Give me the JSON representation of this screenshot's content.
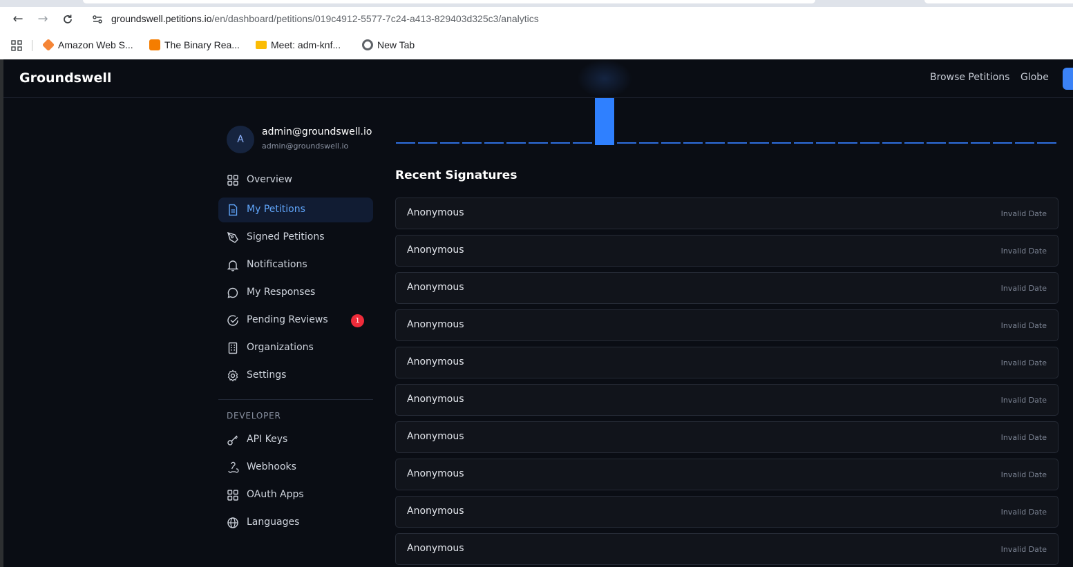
{
  "browser": {
    "url_host": "groundswell.petitions.io",
    "url_path": "/en/dashboard/petitions/019c4912-5577-7c24-a413-829403d325c3/analytics",
    "bookmarks": [
      {
        "label": "Amazon Web S...",
        "icon": "aws-icon",
        "color": "#f58536"
      },
      {
        "label": "The Binary Rea...",
        "icon": "blogger-icon",
        "color": "#f57d00"
      },
      {
        "label": "Meet: adm-knf...",
        "icon": "meet-icon",
        "color": "#fbbc04"
      },
      {
        "label": "New Tab",
        "icon": "chrome-icon",
        "color": "#5f6368"
      }
    ]
  },
  "header": {
    "brand": "Groundswell",
    "links": [
      "Browse Petitions",
      "Globe"
    ]
  },
  "user": {
    "initial": "A",
    "name": "admin@groundswell.io",
    "email": "admin@groundswell.io"
  },
  "sidebar": {
    "items": [
      {
        "label": "Overview",
        "icon": "grid-icon"
      },
      {
        "label": "My Petitions",
        "icon": "document-icon",
        "active": true
      },
      {
        "label": "Signed Petitions",
        "icon": "pen-icon"
      },
      {
        "label": "Notifications",
        "icon": "bell-icon"
      },
      {
        "label": "My Responses",
        "icon": "chat-icon"
      },
      {
        "label": "Pending Reviews",
        "icon": "check-circle-icon",
        "badge": "1"
      },
      {
        "label": "Organizations",
        "icon": "building-icon"
      },
      {
        "label": "Settings",
        "icon": "gear-icon"
      }
    ],
    "developer_label": "DEVELOPER",
    "developer_items": [
      {
        "label": "API Keys",
        "icon": "key-icon"
      },
      {
        "label": "Webhooks",
        "icon": "webhook-icon"
      },
      {
        "label": "OAuth Apps",
        "icon": "grid-icon"
      },
      {
        "label": "Languages",
        "icon": "globe-icon"
      }
    ]
  },
  "chart_data": {
    "type": "bar",
    "bar_count": 30,
    "values": [
      0,
      0,
      0,
      0,
      0,
      0,
      0,
      0,
      0,
      1,
      0,
      0,
      0,
      0,
      0,
      0,
      0,
      0,
      0,
      0,
      0,
      0,
      0,
      0,
      0,
      0,
      0,
      0,
      0,
      0
    ],
    "colors": {
      "bar": "#2f80ff",
      "baseline": "#2f6fe0"
    }
  },
  "signatures": {
    "title": "Recent Signatures",
    "rows": [
      {
        "name": "Anonymous",
        "date": "Invalid Date"
      },
      {
        "name": "Anonymous",
        "date": "Invalid Date"
      },
      {
        "name": "Anonymous",
        "date": "Invalid Date"
      },
      {
        "name": "Anonymous",
        "date": "Invalid Date"
      },
      {
        "name": "Anonymous",
        "date": "Invalid Date"
      },
      {
        "name": "Anonymous",
        "date": "Invalid Date"
      },
      {
        "name": "Anonymous",
        "date": "Invalid Date"
      },
      {
        "name": "Anonymous",
        "date": "Invalid Date"
      },
      {
        "name": "Anonymous",
        "date": "Invalid Date"
      },
      {
        "name": "Anonymous",
        "date": "Invalid Date"
      }
    ]
  }
}
